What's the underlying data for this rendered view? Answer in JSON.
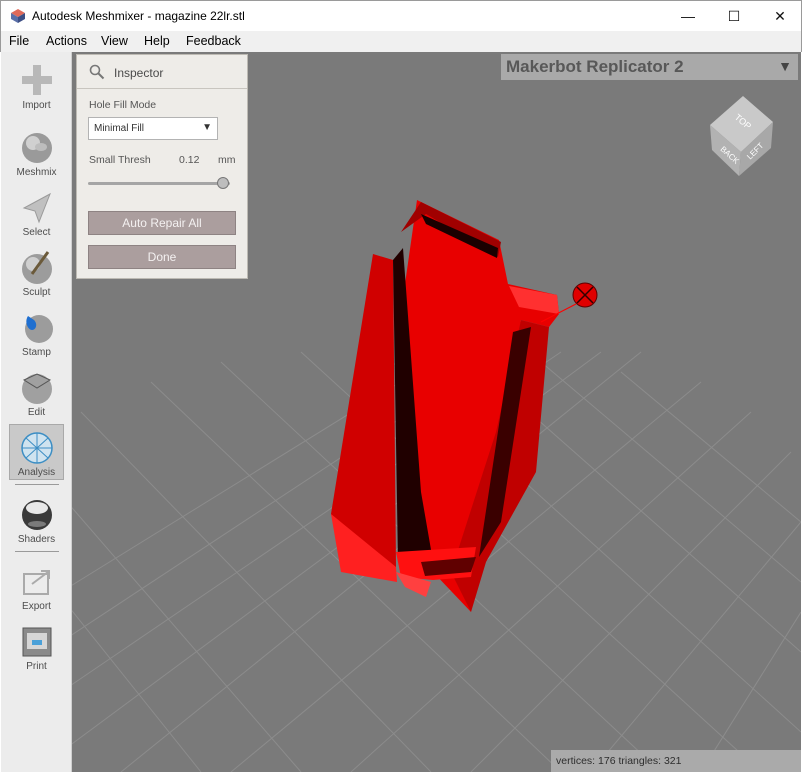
{
  "window": {
    "title": "Autodesk Meshmixer - magazine 22lr.stl",
    "minimize_glyph": "—",
    "maximize_glyph": "☐",
    "close_glyph": "✕"
  },
  "menu": [
    "File",
    "Actions",
    "View",
    "Help",
    "Feedback"
  ],
  "toolbar": {
    "items": [
      {
        "label": "Import",
        "icon": "plus-icon"
      },
      {
        "label": "Meshmix",
        "icon": "bunny-sphere-icon"
      },
      {
        "label": "Select",
        "icon": "arrow-cursor-icon"
      },
      {
        "label": "Sculpt",
        "icon": "brush-sphere-icon"
      },
      {
        "label": "Stamp",
        "icon": "stamp-sphere-icon"
      },
      {
        "label": "Edit",
        "icon": "edit-sphere-icon"
      },
      {
        "label": "Analysis",
        "icon": "mesh-sphere-icon"
      },
      {
        "label": "Shaders",
        "icon": "chrome-sphere-icon"
      },
      {
        "label": "Export",
        "icon": "export-icon"
      },
      {
        "label": "Print",
        "icon": "printer-icon"
      }
    ],
    "active": "Analysis"
  },
  "inspector": {
    "title": "Inspector",
    "hole_fill_mode_label": "Hole Fill Mode",
    "hole_fill_mode_value": "Minimal Fill",
    "small_thresh_label": "Small Thresh",
    "small_thresh_value": "0.12",
    "small_thresh_unit": "mm",
    "small_thresh_slider_fraction": 0.95,
    "auto_repair_label": "Auto Repair All",
    "done_label": "Done"
  },
  "printer": {
    "name": "Makerbot Replicator 2"
  },
  "view_cube": {
    "top": "TOP",
    "back": "BACK",
    "left": "LEFT"
  },
  "status": {
    "text": "vertices: 176 triangles: 321"
  },
  "colors": {
    "model": "#e00000",
    "viewport_bg": "#7a7a7a",
    "button": "#ab9e9e"
  }
}
